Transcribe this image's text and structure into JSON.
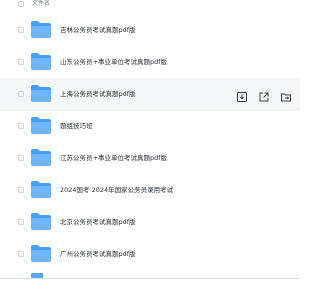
{
  "header": {
    "column_label": "文件名"
  },
  "rows": [
    {
      "name": "吉林公务员考试真题pdf版",
      "icon": "folder-icon"
    },
    {
      "name": "山东公务员+事业单位考试真题pdf版",
      "icon": "folder-icon"
    },
    {
      "name": "上海公务员考试真题pdf版",
      "icon": "folder-icon",
      "hover": true,
      "actions": [
        "download-icon",
        "share-icon",
        "move-to-icon"
      ]
    },
    {
      "name": "题组技巧班",
      "icon": "folder-icon"
    },
    {
      "name": "江苏公务员+事业单位考试真题pdf版",
      "icon": "folder-icon"
    },
    {
      "name": "2024国考 2024年国家公务员录用考试",
      "icon": "folder-icon"
    },
    {
      "name": "北京公务员考试真题pdf版",
      "icon": "folder-icon"
    },
    {
      "name": "广州公务员考试真题pdf版",
      "icon": "folder-icon"
    }
  ],
  "colors": {
    "folder_back": "#4a9bf3",
    "folder_front": "#6db5f8",
    "hover_bg": "#f5f6f7",
    "text": "#2b2f36",
    "muted": "#7a7f87"
  }
}
